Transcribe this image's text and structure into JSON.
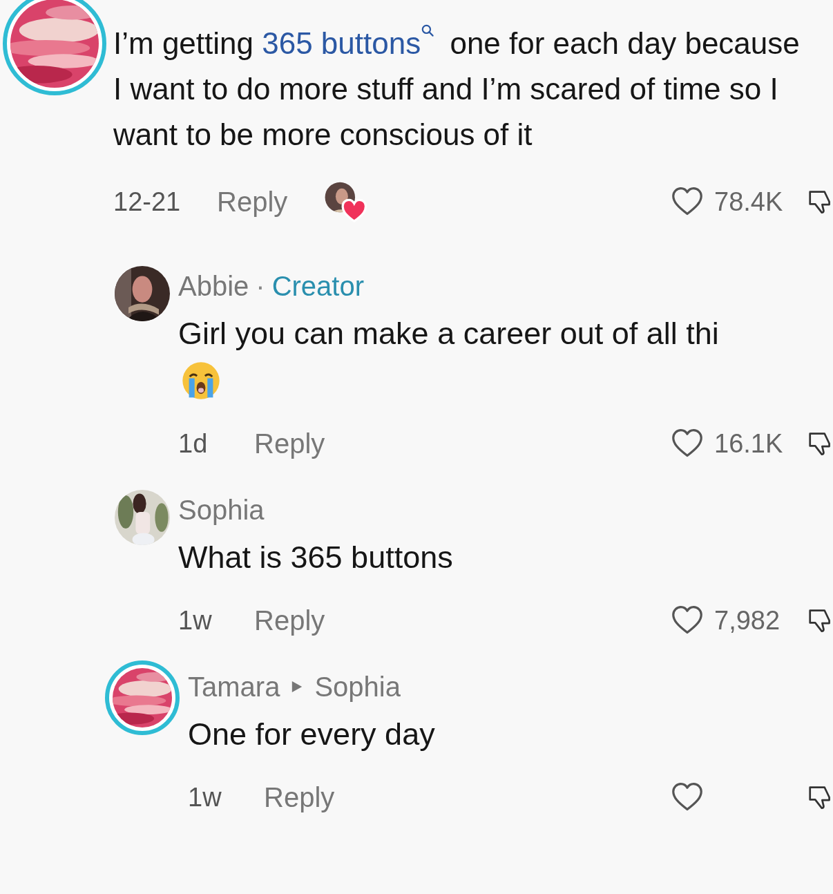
{
  "comments": [
    {
      "avatar": {
        "kind": "abstract",
        "ring": true
      },
      "body": [
        {
          "text": "I’m getting "
        },
        {
          "text": "365 buttons",
          "kind": "search_link"
        },
        {
          "text": " one for each day because I want to do more stuff and I’m scared of time so I want to be more conscious of it"
        }
      ],
      "time": "12-21",
      "reply": "Reply",
      "creator_liked": true,
      "likes": "78.4K"
    },
    {
      "avatar": {
        "kind": "figure",
        "ring": false
      },
      "author": "Abbie",
      "separator": "·",
      "badge": "Creator",
      "body": [
        {
          "text": "Girl you can make a career out of all thi"
        }
      ],
      "emoji": true,
      "time": "1d",
      "reply": "Reply",
      "creator_liked": false,
      "likes": "16.1K"
    },
    {
      "avatar": {
        "kind": "plant",
        "ring": false
      },
      "author": "Sophia",
      "body": [
        {
          "text": "What is 365 buttons"
        }
      ],
      "time": "1w",
      "reply": "Reply",
      "creator_liked": false,
      "likes": "7,982"
    },
    {
      "avatar": {
        "kind": "abstract",
        "ring": true
      },
      "author": "Tamara",
      "reply_to": "Sophia",
      "body": [
        {
          "text": "One for every day"
        }
      ],
      "time": "1w",
      "reply": "Reply",
      "creator_liked": false
    }
  ]
}
